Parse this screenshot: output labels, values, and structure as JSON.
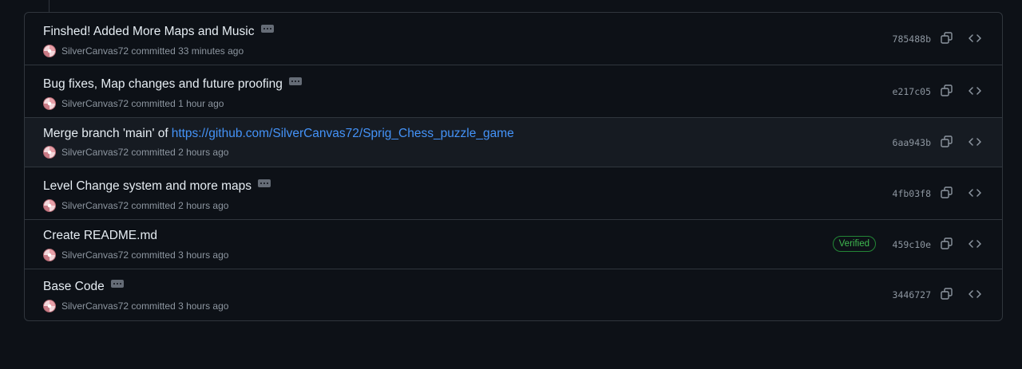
{
  "commits": [
    {
      "message": "Finshed! Added More Maps and Music",
      "link": "",
      "has_ellipsis": true,
      "author": "SilverCanvas72",
      "meta": "committed 33 minutes ago",
      "verified": "",
      "sha": "785488b"
    },
    {
      "message": "Bug fixes, Map changes and future proofing",
      "link": "",
      "has_ellipsis": true,
      "author": "SilverCanvas72",
      "meta": "committed 1 hour ago",
      "verified": "",
      "sha": "e217c05"
    },
    {
      "message": "Merge branch 'main' of",
      "link": "https://github.com/SilverCanvas72/Sprig_Chess_puzzle_game",
      "has_ellipsis": false,
      "author": "SilverCanvas72",
      "meta": "committed 2 hours ago",
      "verified": "",
      "sha": "6aa943b"
    },
    {
      "message": "Level Change system and more maps",
      "link": "",
      "has_ellipsis": true,
      "author": "SilverCanvas72",
      "meta": "committed 2 hours ago",
      "verified": "",
      "sha": "4fb03f8"
    },
    {
      "message": "Create README.md",
      "link": "",
      "has_ellipsis": false,
      "author": "SilverCanvas72",
      "meta": "committed 3 hours ago",
      "verified": "Verified",
      "sha": "459c10e"
    },
    {
      "message": "Base Code",
      "link": "",
      "has_ellipsis": true,
      "author": "SilverCanvas72",
      "meta": "committed 3 hours ago",
      "verified": "",
      "sha": "3446727"
    }
  ],
  "icons": {
    "copy": "copy-icon",
    "browse": "code-icon",
    "ellipsis": "kebab-horizontal-icon"
  },
  "colors": {
    "background": "#0d1117",
    "border": "#30363d",
    "link": "#4493f8",
    "verified": "#3fb950",
    "muted": "#8d96a0"
  }
}
